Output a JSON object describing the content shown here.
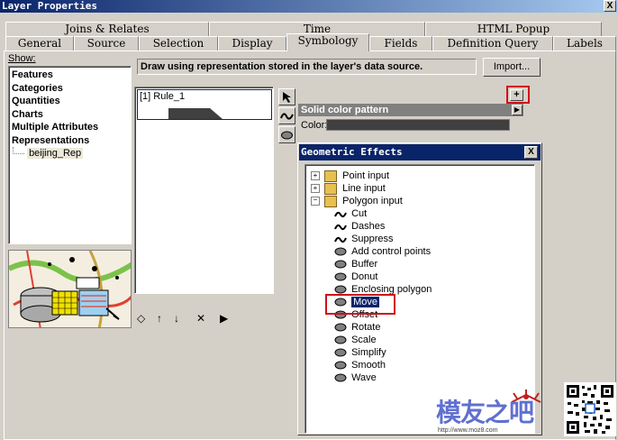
{
  "window": {
    "title": "Layer Properties",
    "close": "X"
  },
  "tabs_row1": [
    "Joins & Relates",
    "Time",
    "HTML Popup"
  ],
  "tabs_row2": [
    "General",
    "Source",
    "Selection",
    "Display",
    "Symbology",
    "Fields",
    "Definition Query",
    "Labels"
  ],
  "show": {
    "label": "Show:",
    "items": [
      "Features",
      "Categories",
      "Quantities",
      "Charts",
      "Multiple Attributes",
      "Representations"
    ],
    "sub_item": "beijing_Rep"
  },
  "description": "Draw using representation stored in the layer's data source.",
  "import_button": "Import...",
  "rule": {
    "label": "[1] Rule_1"
  },
  "pattern": {
    "title": "Solid color pattern",
    "color_label": "Color:",
    "add_button": "+"
  },
  "effects_dialog": {
    "title": "Geometric Effects",
    "close": "X",
    "groups": [
      "Point input",
      "Line input",
      "Polygon input"
    ],
    "line_items": [
      "Cut",
      "Dashes",
      "Suppress"
    ],
    "poly_items": [
      "Add control points",
      "Buffer",
      "Donut",
      "Enclosing polygon",
      "Move",
      "Offset",
      "Rotate",
      "Scale",
      "Simplify",
      "Smooth",
      "Wave"
    ],
    "selected": "Move"
  },
  "watermark": {
    "brand": "模友之吧",
    "url": "http://www.moz8.com"
  },
  "colors": {
    "accent_red": "#d01018",
    "title_blue": "#0a246a",
    "selection_blue": "#0a246a",
    "face": "#d4d0c8"
  }
}
